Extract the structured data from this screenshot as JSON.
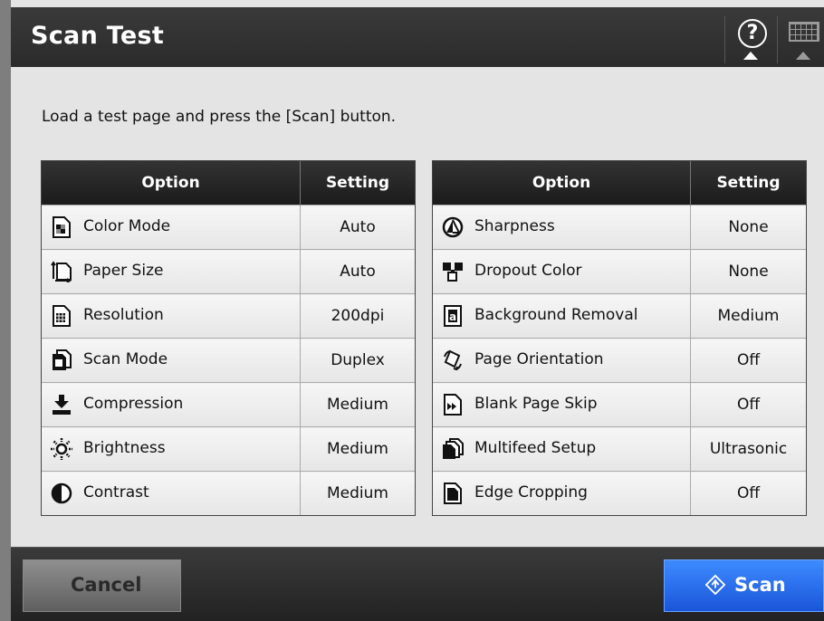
{
  "window": {
    "title": "Scan Test"
  },
  "header": {
    "help_glyph": "?"
  },
  "instruction": "Load a test page and press the [Scan] button.",
  "tables": {
    "left": {
      "headers": {
        "option": "Option",
        "setting": "Setting"
      },
      "rows": [
        {
          "icon": "color-mode-icon",
          "label": "Color Mode",
          "value": "Auto"
        },
        {
          "icon": "paper-size-icon",
          "label": "Paper Size",
          "value": "Auto"
        },
        {
          "icon": "resolution-icon",
          "label": "Resolution",
          "value": "200dpi"
        },
        {
          "icon": "scan-mode-icon",
          "label": "Scan Mode",
          "value": "Duplex"
        },
        {
          "icon": "compression-icon",
          "label": "Compression",
          "value": "Medium"
        },
        {
          "icon": "brightness-icon",
          "label": "Brightness",
          "value": "Medium"
        },
        {
          "icon": "contrast-icon",
          "label": "Contrast",
          "value": "Medium"
        }
      ]
    },
    "right": {
      "headers": {
        "option": "Option",
        "setting": "Setting"
      },
      "rows": [
        {
          "icon": "sharpness-icon",
          "label": "Sharpness",
          "value": "None"
        },
        {
          "icon": "dropout-color-icon",
          "label": "Dropout Color",
          "value": "None"
        },
        {
          "icon": "background-removal-icon",
          "label": "Background Removal",
          "value": "Medium"
        },
        {
          "icon": "page-orientation-icon",
          "label": "Page Orientation",
          "value": "Off"
        },
        {
          "icon": "blank-page-skip-icon",
          "label": "Blank Page Skip",
          "value": "Off"
        },
        {
          "icon": "multifeed-setup-icon",
          "label": "Multifeed Setup",
          "value": "Ultrasonic"
        },
        {
          "icon": "edge-cropping-icon",
          "label": "Edge Cropping",
          "value": "Off"
        }
      ]
    }
  },
  "footer": {
    "cancel_label": "Cancel",
    "scan_label": "Scan"
  },
  "colors": {
    "title_bar": "#2b2b2b",
    "scan_button": "#2a6cf0",
    "cancel_button": "#7a7a7a",
    "content_bg": "#e4e4e4"
  }
}
